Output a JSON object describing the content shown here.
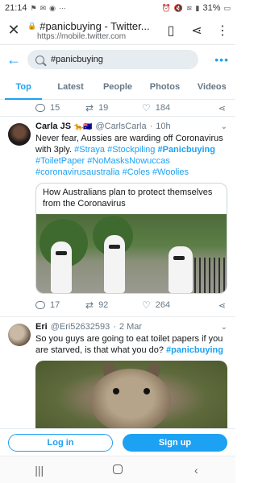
{
  "status": {
    "time": "21:14",
    "battery": "31%"
  },
  "browser": {
    "title": "#panicbuying - Twitter...",
    "url": "https://mobile.twitter.com"
  },
  "search": {
    "query": "#panicbuying"
  },
  "tabs": [
    {
      "label": "Top",
      "active": true
    },
    {
      "label": "Latest",
      "active": false
    },
    {
      "label": "People",
      "active": false
    },
    {
      "label": "Photos",
      "active": false
    },
    {
      "label": "Videos",
      "active": false
    }
  ],
  "prev_tweet": {
    "replies": "15",
    "retweets": "19",
    "likes": "184"
  },
  "tweet1": {
    "name": "Carla JS",
    "handle": "@CarlsCarla",
    "time": "10h",
    "text_plain": "Never fear, Aussies are warding off Coronavirus with 3ply.",
    "tags": [
      "#Straya",
      "#Stockpiling",
      "#Panicbuying",
      "#ToiletPaper",
      "#NoMasksNowuccas",
      "#coronavirusaustralia",
      "#Coles",
      "#Woolies"
    ],
    "card_title": "How Australians plan to protect themselves from the Coronavirus",
    "replies": "17",
    "retweets": "92",
    "likes": "264"
  },
  "tweet2": {
    "name": "Eri",
    "handle": "@Eri52632593",
    "time": "2 Mar",
    "text_plain": "So you guys are going to eat toilet papers if you are starved, is that what you do?",
    "tag": "#panicbuying"
  },
  "cta": {
    "login": "Log in",
    "signup": "Sign up"
  },
  "colors": {
    "accent": "#1da1f2",
    "muted": "#657786"
  }
}
